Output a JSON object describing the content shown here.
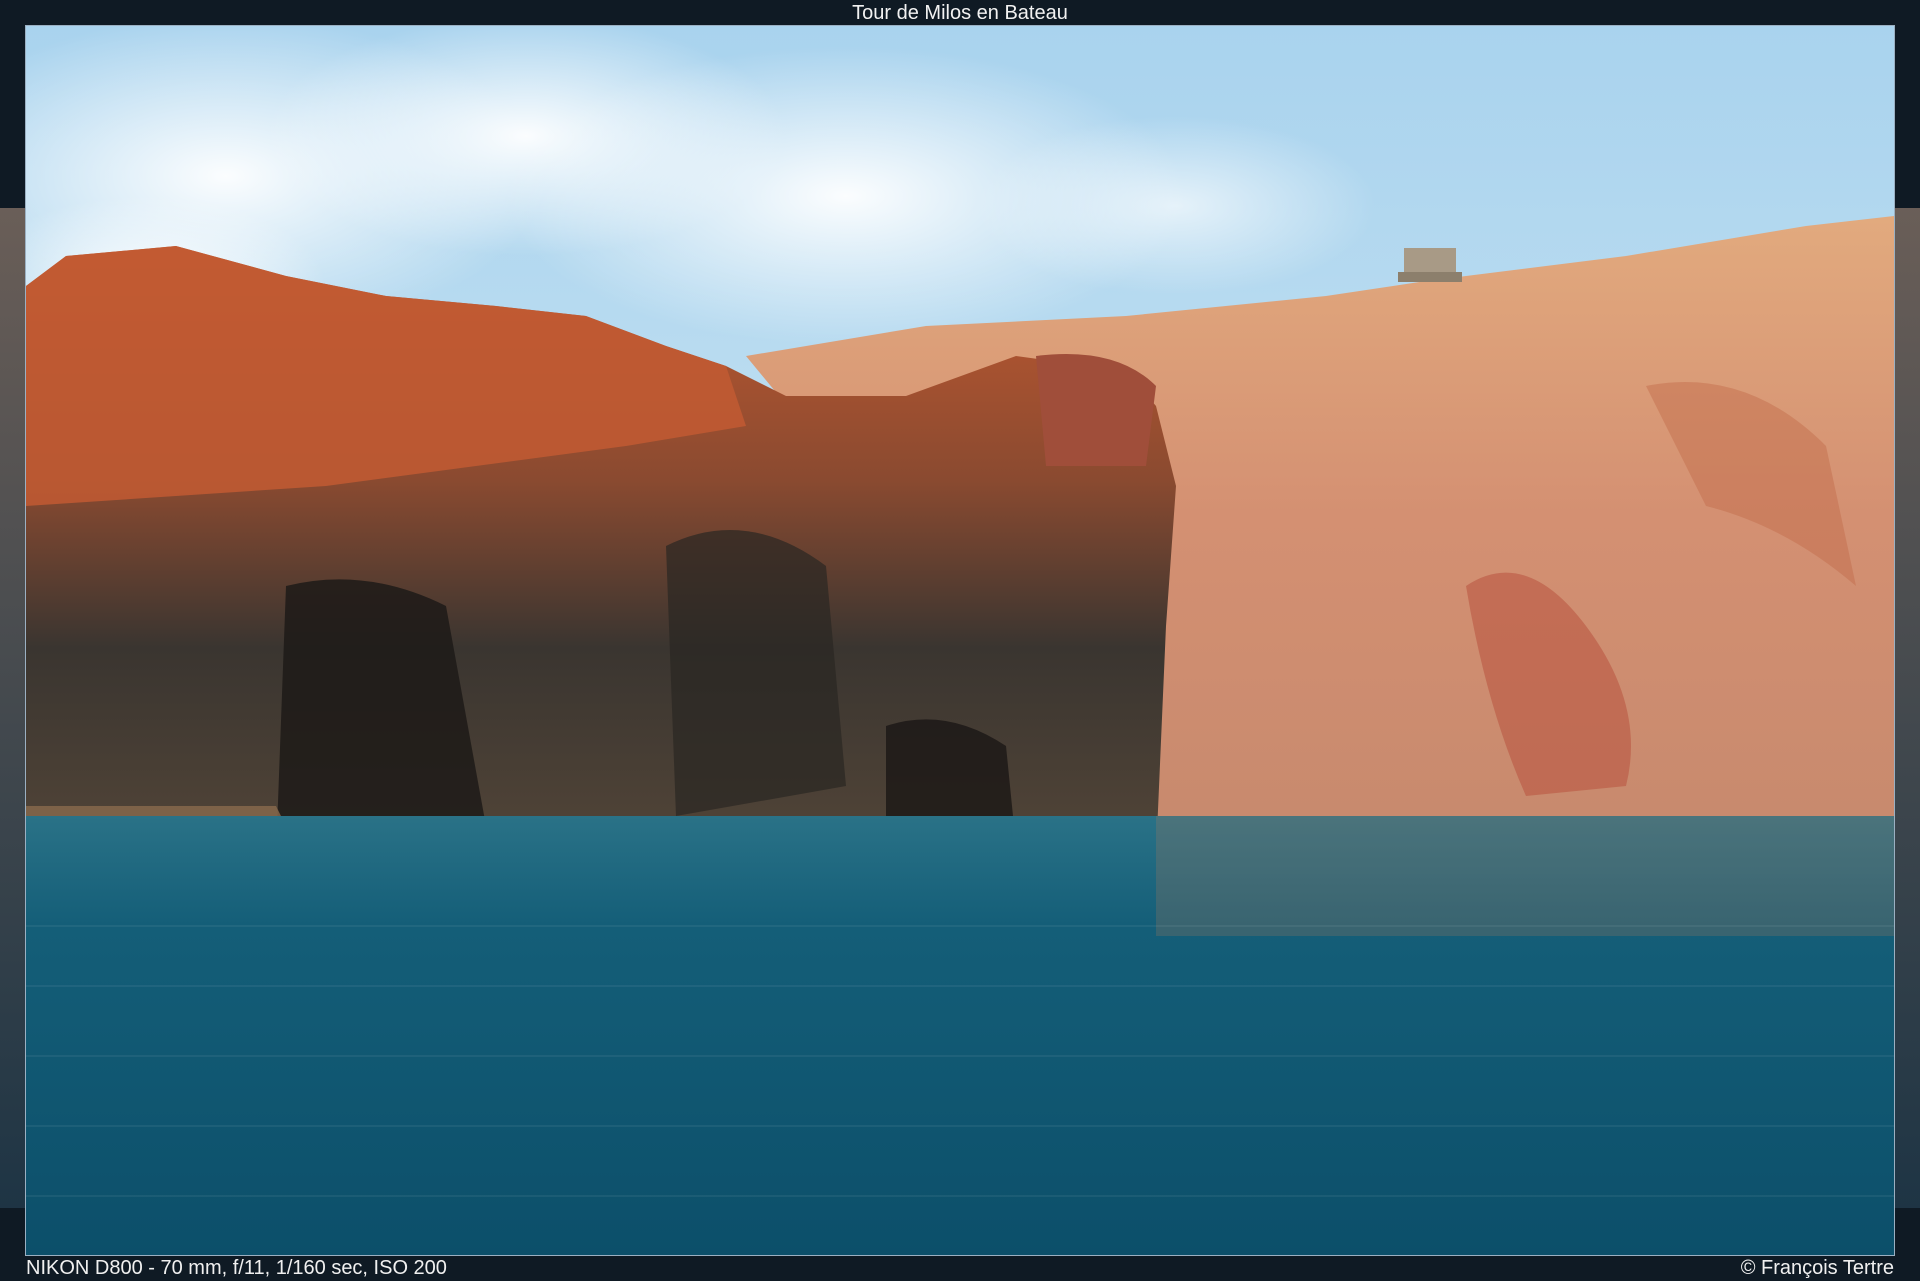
{
  "viewer": {
    "title": "Tour de Milos en Bateau",
    "exif": "NIKON D800 - 70 mm, f/11, 1/160 sec, ISO 200",
    "copyright": "© François Tertre"
  },
  "scene": {
    "description_icon": "landscape-photo",
    "colors": {
      "sky": "#b7dcf0",
      "cloud": "#f4f6f7",
      "rock_red": "#b8542e",
      "rock_dark": "#2e2a26",
      "cliff_sand": "#d9a07a",
      "sea": "#0f5670"
    }
  }
}
